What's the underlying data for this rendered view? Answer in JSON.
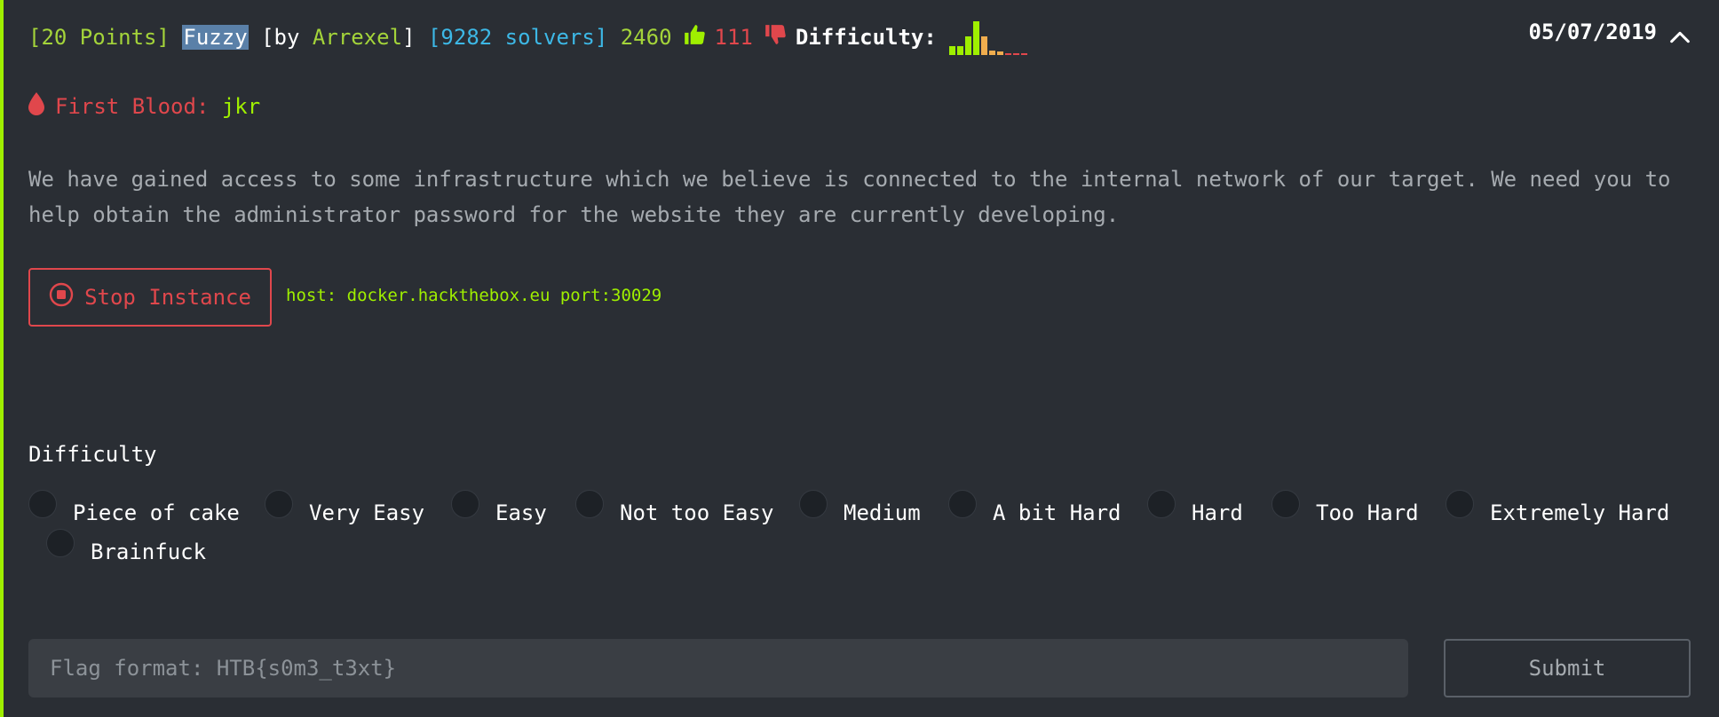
{
  "challenge": {
    "points": "[20 Points]",
    "name": "Fuzzy",
    "by_prefix": "[by",
    "author": "Arrexel",
    "by_suffix": "]",
    "solvers": "[9282 solvers]",
    "likes": "2460",
    "dislikes": "111",
    "difficulty_label": "Difficulty:",
    "difficulty_distribution": [
      {
        "level": 1,
        "fraction": 0.25,
        "color": "#9fef00"
      },
      {
        "level": 2,
        "fraction": 0.25,
        "color": "#9fef00"
      },
      {
        "level": 3,
        "fraction": 0.55,
        "color": "#9fef00"
      },
      {
        "level": 4,
        "fraction": 1.0,
        "color": "#9fef00"
      },
      {
        "level": 5,
        "fraction": 0.55,
        "color": "#f0ad4e"
      },
      {
        "level": 6,
        "fraction": 0.12,
        "color": "#f0ad4e"
      },
      {
        "level": 7,
        "fraction": 0.1,
        "color": "#f0ad4e"
      },
      {
        "level": 8,
        "fraction": 0.05,
        "color": "#e0474c"
      },
      {
        "level": 9,
        "fraction": 0.05,
        "color": "#e0474c"
      },
      {
        "level": 10,
        "fraction": 0.05,
        "color": "#e0474c"
      }
    ],
    "date": "05/07/2019"
  },
  "first_blood": {
    "label": "First Blood:",
    "user": "jkr"
  },
  "description": "We have gained access to some infrastructure which we believe is connected to the internal network of our target. We need you to help obtain the administrator password for the website they are currently developing.",
  "instance": {
    "stop_label": "Stop Instance",
    "host_text": "host: docker.hackthebox.eu port:30029"
  },
  "difficulty_vote": {
    "heading": "Difficulty",
    "options": [
      "Piece of cake",
      "Very Easy",
      "Easy",
      "Not too Easy",
      "Medium",
      "A bit Hard",
      "Hard",
      "Too Hard",
      "Extremely Hard",
      "Brainfuck"
    ]
  },
  "flag": {
    "placeholder": "Flag format: HTB{s0m3_t3xt}",
    "value": "",
    "submit_label": "Submit"
  },
  "colors": {
    "accent": "#9fef00",
    "danger": "#e0474c",
    "info": "#3db8e6",
    "warning": "#f0ad4e",
    "background": "#2a2e34"
  }
}
